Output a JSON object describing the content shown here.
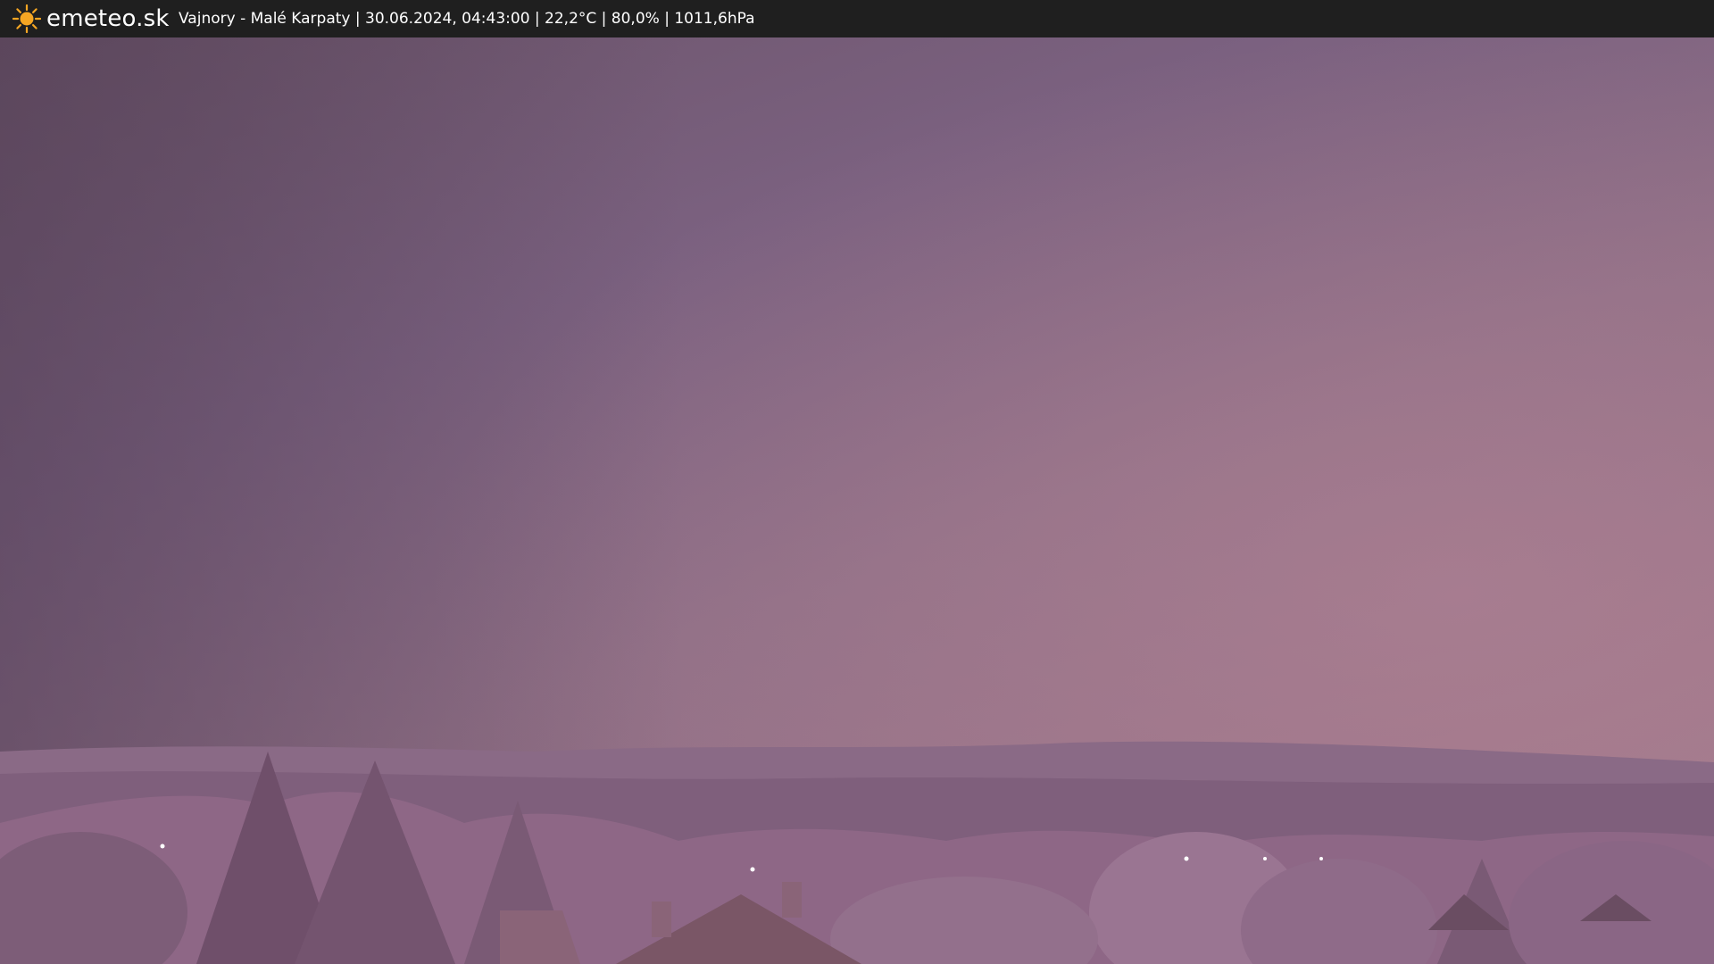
{
  "header": {
    "brand": "emeteo.sk",
    "info": "Vajnory - Malé Karpaty | 30.06.2024, 04:43:00 | 22,2°C | 80,0% | 1011,6hPa",
    "logo_icon": "sun-icon"
  },
  "colors": {
    "bar": "#1f1f1f",
    "sun": "#f5a623",
    "sky_top": "#6f5670",
    "sky_bottom": "#a07b8b",
    "foliage": "#8e6786"
  }
}
